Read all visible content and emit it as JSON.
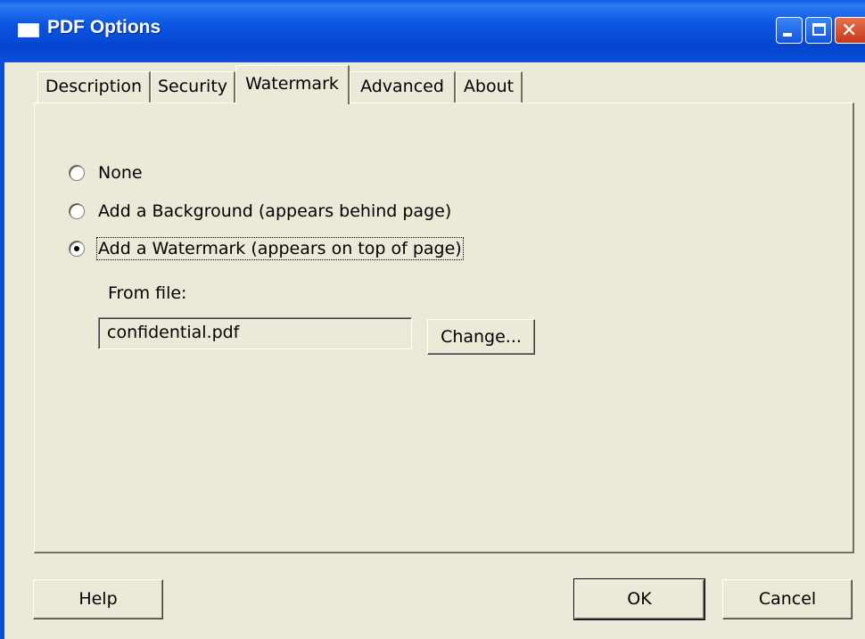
{
  "window": {
    "title": "PDF Options",
    "controls": [
      "minimize",
      "maximize",
      "close"
    ]
  },
  "tabs": [
    {
      "label": "Description",
      "active": false
    },
    {
      "label": "Security",
      "active": false
    },
    {
      "label": "Watermark",
      "active": true
    },
    {
      "label": "Advanced",
      "active": false
    },
    {
      "label": "About",
      "active": false
    }
  ],
  "watermark": {
    "options": [
      {
        "label": "None",
        "selected": false
      },
      {
        "label": "Add a Background (appears behind page)",
        "selected": false
      },
      {
        "label": "Add a Watermark (appears on top of page)",
        "selected": true
      }
    ],
    "from_file_label": "From file:",
    "file_value": "confidential.pdf",
    "change_label": "Change..."
  },
  "footer": {
    "help_label": "Help",
    "ok_label": "OK",
    "cancel_label": "Cancel"
  },
  "colors": {
    "titlebar": "#0A55E0",
    "window_bg": "#ECE9D8",
    "close_button": "#D04A2A"
  }
}
